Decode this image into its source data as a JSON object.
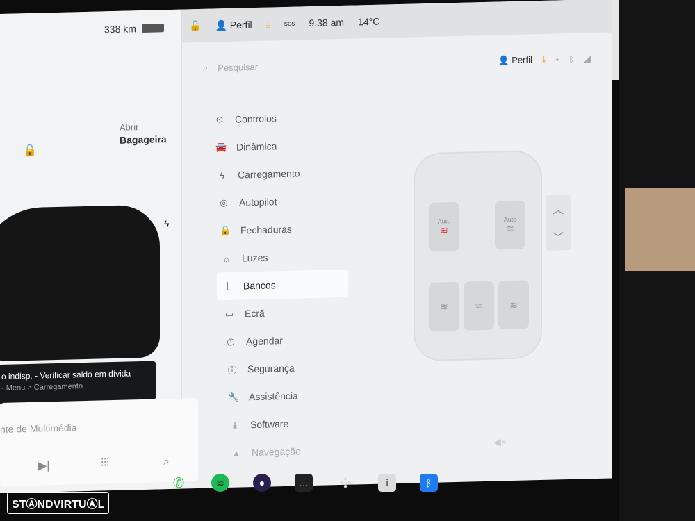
{
  "status": {
    "range": "338 km",
    "profile": "Perfil",
    "sos": "sos",
    "time": "9:38 am",
    "temp": "14°C"
  },
  "search": {
    "placeholder": "Pesquisar",
    "profile": "Perfil"
  },
  "left": {
    "open_label": "Abrir",
    "trunk_label": "Bagageira"
  },
  "toast": {
    "title": "o indisp. - Verificar saldo em dívida",
    "subtitle": "- Menu > Carregamento"
  },
  "media": {
    "source": "nte de Multimédia"
  },
  "menu": [
    {
      "label": "Controlos",
      "icon": "toggle-icon",
      "glyph": "⊙"
    },
    {
      "label": "Dinâmica",
      "icon": "car-icon",
      "glyph": "🚘"
    },
    {
      "label": "Carregamento",
      "icon": "bolt-icon",
      "glyph": "ϟ"
    },
    {
      "label": "Autopilot",
      "icon": "steering-wheel-icon",
      "glyph": "◎"
    },
    {
      "label": "Fechaduras",
      "icon": "lock-icon",
      "glyph": "🔒"
    },
    {
      "label": "Luzes",
      "icon": "light-icon",
      "glyph": "☼"
    },
    {
      "label": "Bancos",
      "icon": "seat-icon",
      "glyph": "⌊"
    },
    {
      "label": "Ecrã",
      "icon": "display-icon",
      "glyph": "▭"
    },
    {
      "label": "Agendar",
      "icon": "clock-icon",
      "glyph": "◷"
    },
    {
      "label": "Segurança",
      "icon": "security-icon",
      "glyph": "ⓘ"
    },
    {
      "label": "Assistência",
      "icon": "wrench-icon",
      "glyph": "🔧"
    },
    {
      "label": "Software",
      "icon": "download-icon",
      "glyph": "⤓"
    },
    {
      "label": "Navegação",
      "icon": "navigation-icon",
      "glyph": "▲"
    }
  ],
  "active_menu": "Bancos",
  "seats": {
    "auto_label": "Auto"
  },
  "watermark": "STANDVIRTUAL",
  "colors": {
    "accent": "#e8a020",
    "spotify": "#1db954",
    "phone": "#2ecc40",
    "bluetooth": "#1e7cf0"
  }
}
